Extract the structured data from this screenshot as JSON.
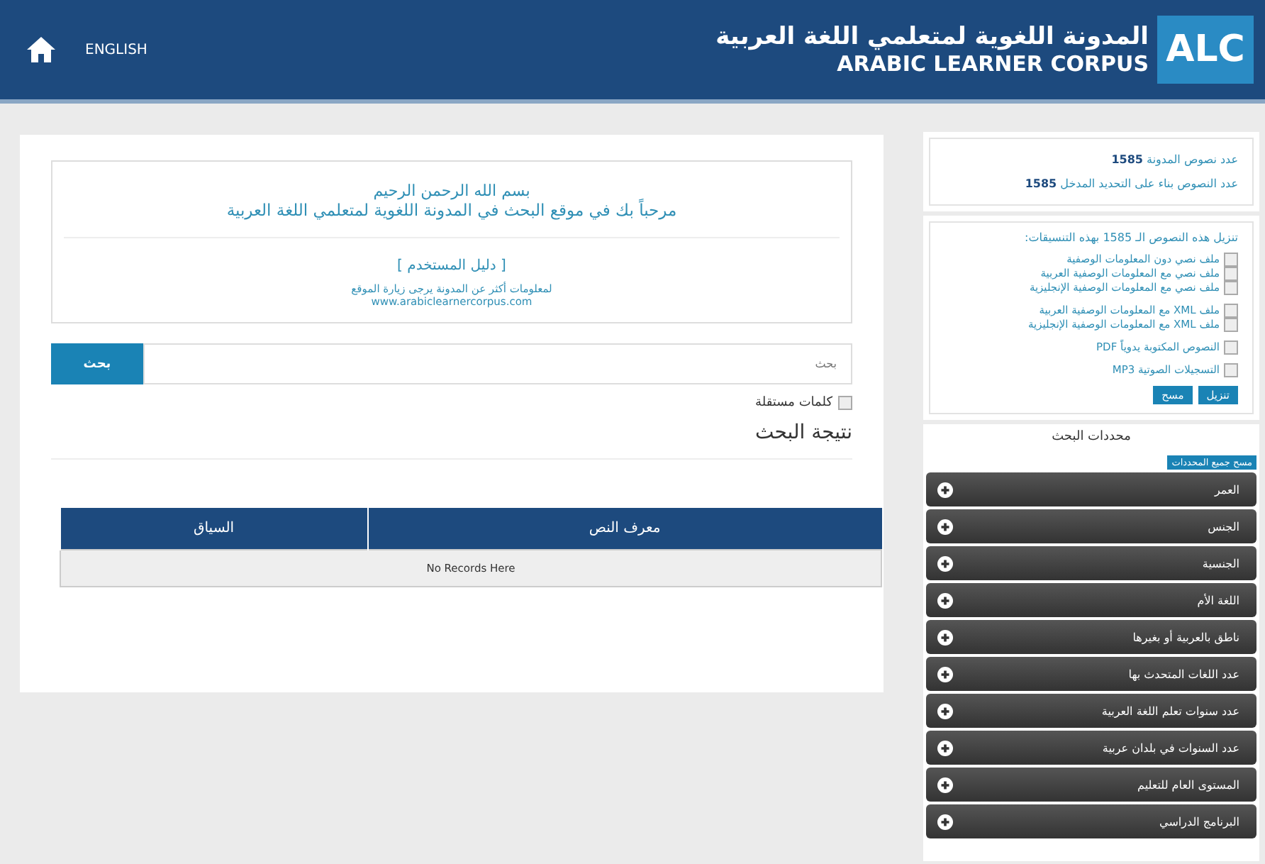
{
  "header": {
    "logo": "ALC",
    "title_ar": "المدونة اللغوية لمتعلمي اللغة العربية",
    "title_en": "ARABIC LEARNER CORPUS",
    "language_link": "ENGLISH"
  },
  "welcome": {
    "basmala": "بسم الله الرحمن الرحيم",
    "greeting": "مرحباً بك في موقع البحث في المدونة اللغوية لمتعلمي اللغة العربية",
    "guide_link": "[ دليل المستخدم ]",
    "info": "لمعلومات أكثر عن المدونة يرجى زيارة الموقع",
    "website": "www.arabiclearnercorpus.com"
  },
  "search": {
    "placeholder": "بحث",
    "button": "بحث",
    "option": {
      "label": "كلمات مستقلة",
      "checked": false
    }
  },
  "results": {
    "title": "نتيجة البحث",
    "columns": [
      "معرف النص",
      "السياق"
    ],
    "empty": "No Records Here"
  },
  "stats": [
    {
      "label": "عدد نصوص المدونة",
      "value": "1585"
    },
    {
      "label": "عدد النصوص بناء على التحديد المدخل",
      "value": "1585"
    }
  ],
  "download": {
    "title": "تنزيل هذه النصوص الـ 1585 بهذه التنسيقات:",
    "groups": [
      [
        {
          "label": "ملف نصي دون المعلومات الوصفية",
          "checked": false
        },
        {
          "label": "ملف نصي مع المعلومات الوصفية العربية",
          "checked": false
        },
        {
          "label": "ملف نصي مع المعلومات الوصفية الإنجليزية",
          "checked": false
        }
      ],
      [
        {
          "label": "ملف XML مع المعلومات الوصفية العربية",
          "checked": false
        },
        {
          "label": "ملف XML مع المعلومات الوصفية الإنجليزية",
          "checked": false
        }
      ],
      [
        {
          "label": "النصوص المكتوبة يدوياً PDF",
          "checked": false
        }
      ],
      [
        {
          "label": "التسجيلات الصوتية MP3",
          "checked": false
        }
      ]
    ],
    "buttons": [
      "تنزيل",
      "مسح"
    ]
  },
  "filters": {
    "title": "محددات البحث",
    "clear": "مسح جميع المحددات",
    "items": [
      {
        "label": "العمر"
      },
      {
        "label": "الجنس"
      },
      {
        "label": "الجنسية"
      },
      {
        "label": "اللغة الأم"
      },
      {
        "label": "ناطق بالعربية أو بغيرها"
      },
      {
        "label": "عدد اللغات المتحدث بها"
      },
      {
        "label": "عدد سنوات تعلم اللغة العربية"
      },
      {
        "label": "عدد السنوات في بلدان عربية"
      },
      {
        "label": "المستوى العام للتعليم"
      },
      {
        "label": "البرنامج الدراسي"
      }
    ]
  }
}
